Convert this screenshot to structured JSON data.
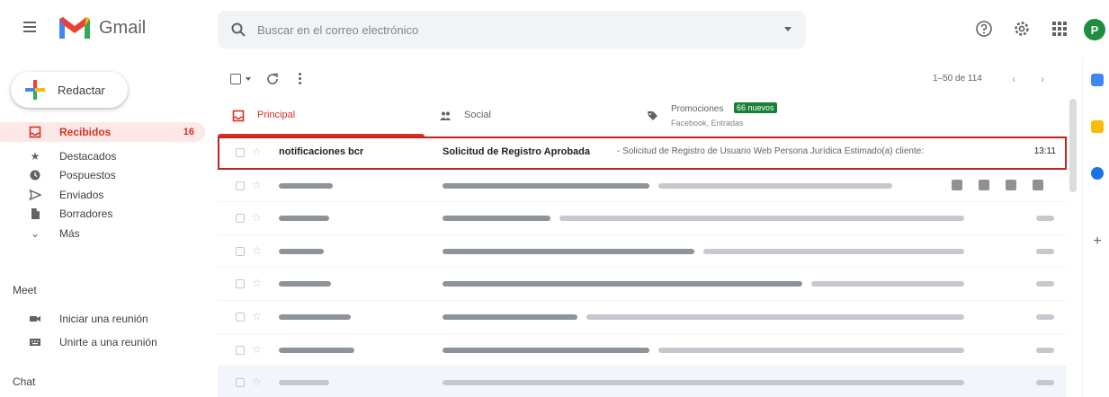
{
  "app": {
    "logo_text": "Gmail"
  },
  "search": {
    "placeholder": "Buscar en el correo electrónico"
  },
  "account": {
    "avatar_initial": "P"
  },
  "compose": {
    "label": "Redactar"
  },
  "nav": {
    "items": [
      {
        "label": "Recibidos",
        "count": "16",
        "icon": "inbox-icon"
      },
      {
        "label": "Destacados",
        "icon": "star-icon"
      },
      {
        "label": "Pospuestos",
        "icon": "clock-icon"
      },
      {
        "label": "Enviados",
        "icon": "send-icon"
      },
      {
        "label": "Borradores",
        "icon": "draft-icon"
      },
      {
        "label": "Más",
        "icon": "chevron-down-icon"
      }
    ]
  },
  "meet": {
    "title": "Meet",
    "items": [
      {
        "label": "Iniciar una reunión",
        "icon": "video-icon"
      },
      {
        "label": "Unirte a una reunión",
        "icon": "keyboard-icon"
      }
    ]
  },
  "chat": {
    "title": "Chat"
  },
  "toolbar": {
    "pagination": "1–50 de 114"
  },
  "tabs": [
    {
      "label": "Principal",
      "icon": "inbox-tab-icon"
    },
    {
      "label": "Social",
      "icon": "people-icon"
    },
    {
      "label": "Promociones",
      "badge": "66 nuevos",
      "sub": "Facebook, Entradas",
      "icon": "tag-icon"
    }
  ],
  "messages": [
    {
      "sender": "notificaciones bcr",
      "subject": "Solicitud de Registro Aprobada",
      "snippet": "- Solicitud de Registro de Usuario Web Persona Jurídica Estimado(a) cliente:",
      "time": "13:11"
    }
  ],
  "colors": {
    "accent_red": "#d93025",
    "highlight_border": "#c5221f",
    "unread_bg": "#ffffff",
    "read_bg": "#f2f6fc",
    "promo_badge": "#188038"
  }
}
